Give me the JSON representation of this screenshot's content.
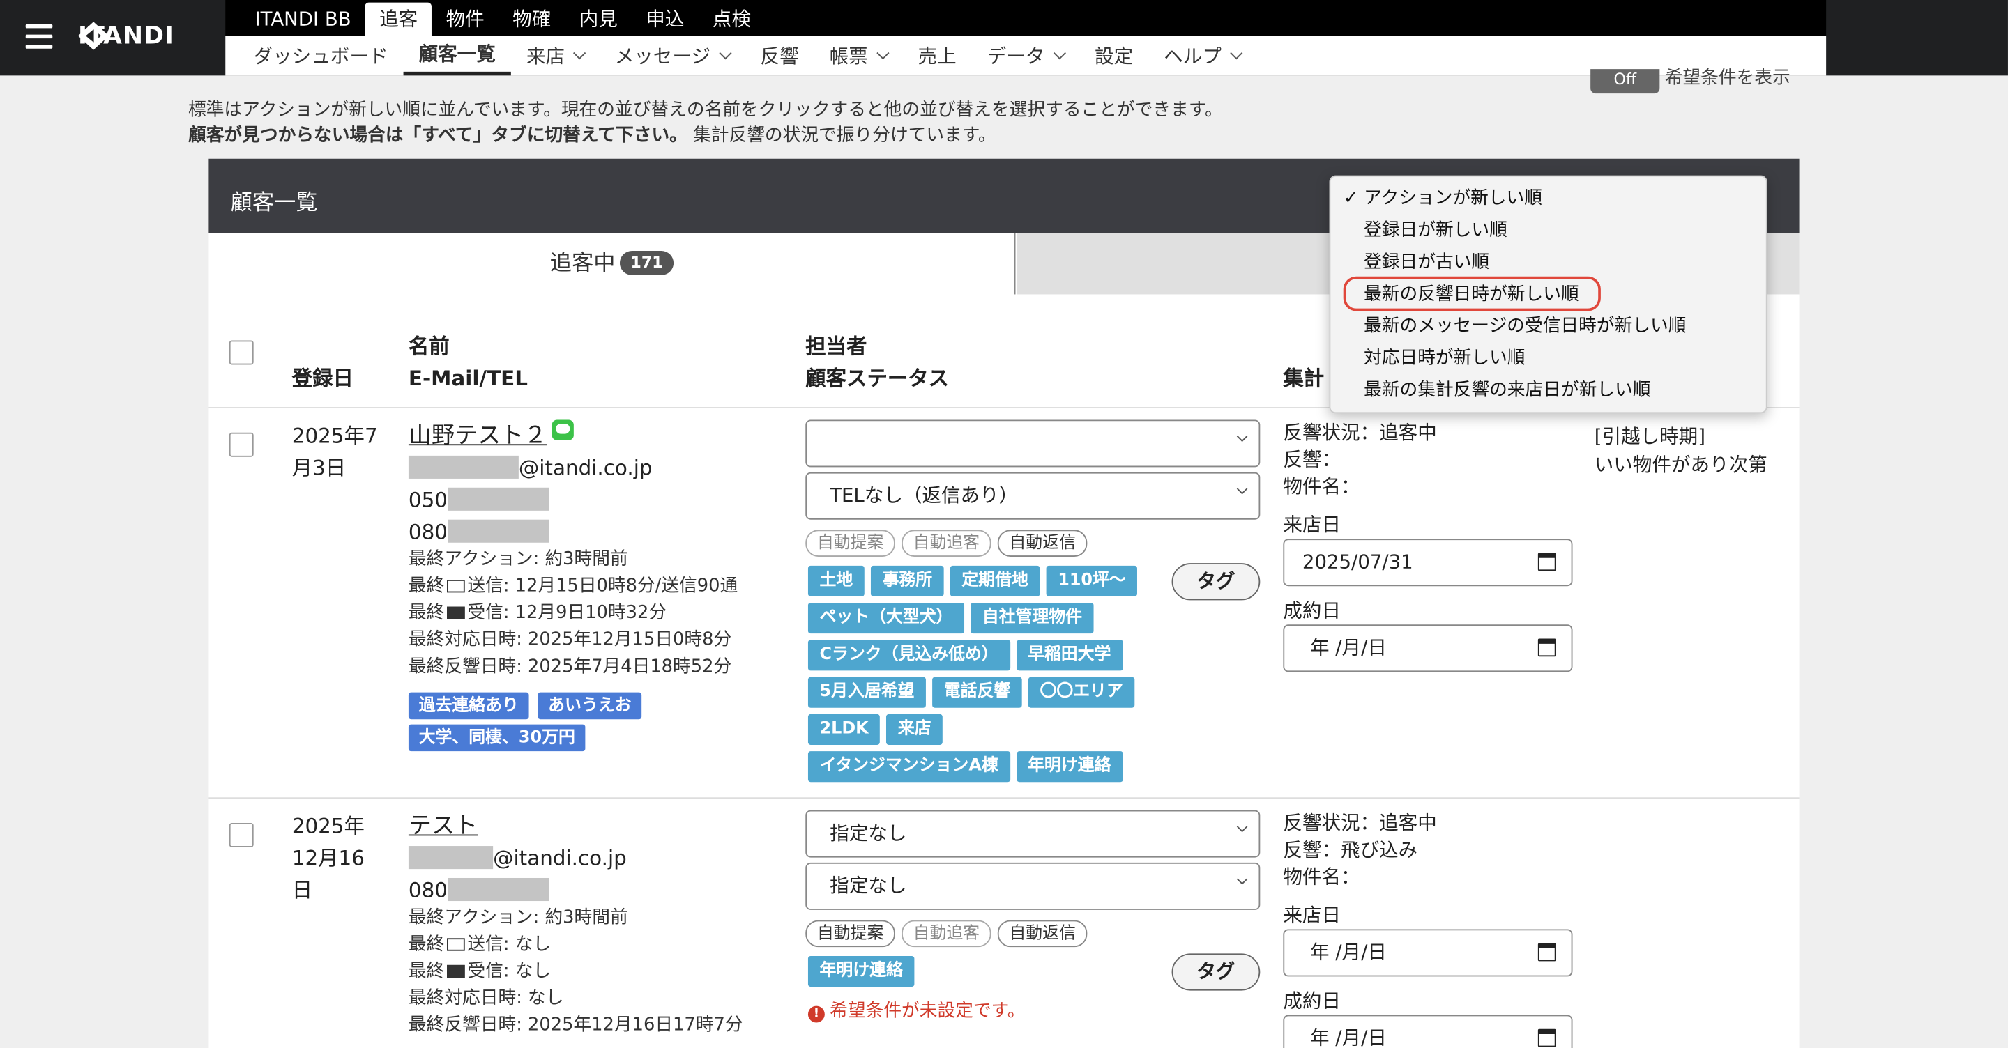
{
  "app": {
    "logo": "ITANDI"
  },
  "nav_top": [
    "ITANDI BB",
    "追客",
    "物件",
    "物確",
    "内見",
    "申込",
    "点検"
  ],
  "nav_sub": [
    {
      "label": "ダッシュボード",
      "dropdown": false
    },
    {
      "label": "顧客一覧",
      "dropdown": false
    },
    {
      "label": "来店",
      "dropdown": true
    },
    {
      "label": "メッセージ",
      "dropdown": true
    },
    {
      "label": "反響",
      "dropdown": false
    },
    {
      "label": "帳票",
      "dropdown": true
    },
    {
      "label": "売上",
      "dropdown": false
    },
    {
      "label": "データ",
      "dropdown": true
    },
    {
      "label": "設定",
      "dropdown": false
    },
    {
      "label": "ヘルプ",
      "dropdown": true
    }
  ],
  "toggle": {
    "state": "Off",
    "label": "希望条件を表示"
  },
  "info": {
    "line1": "標準はアクションが新しい順に並んでいます。現在の並び替えの名前をクリックすると他の並び替えを選択することができます。",
    "line2_bold": "顧客が見つからない場合は「すべて」タブに切替えて下さい。",
    "line2_rest": "集計反響の状況で振り分けています。"
  },
  "panel": {
    "title": "顧客一覧",
    "tab_label": "追客中",
    "tab_count": "171"
  },
  "columns": {
    "date": "登録日",
    "name1": "名前",
    "name2": "E-Mail/TEL",
    "staff1": "担当者",
    "staff2": "顧客ステータス",
    "agg": "集計"
  },
  "sort_menu": {
    "check": "✓",
    "items": [
      "アクションが新しい順",
      "登録日が新しい順",
      "登録日が古い順",
      "最新の反響日時が新しい順",
      "最新のメッセージの受信日時が新しい順",
      "対応日時が新しい順",
      "最新の集計反響の来店日が新しい順"
    ],
    "selected": "アクションが新しい順",
    "highlighted": "最新の反響日時が新しい順"
  },
  "rows": [
    {
      "date1": "2025年7",
      "date2": "月3日",
      "name": "山野テスト２",
      "email_domain": "@itandi.co.jp",
      "tel1": "050",
      "tel2": "080",
      "last_action": "最終アクション: 約3時間前",
      "sent_prefix": "最終",
      "sent": "送信: 12月15日0時8分/送信90通",
      "recv_prefix": "最終",
      "recv": "受信: 12月9日10時32分",
      "last_contact": "最終対応日時: 2025年12月15日0時8分",
      "last_response": "最終反響日時: 2025年7月4日18時52分",
      "badges": [
        "過去連絡あり",
        "あいうえお",
        "大学、同棲、30万円"
      ],
      "staff_select": "",
      "status_select": "TELなし（返信あり）",
      "pills": [
        "自動提案",
        "自動追客",
        "自動返信"
      ],
      "tags": [
        "土地",
        "事務所",
        "定期借地",
        "110坪〜",
        "ペット（大型犬）",
        "自社管理物件",
        "Cランク（見込み低め）",
        "早稲田大学",
        "5月入居希望",
        "電話反響",
        "〇〇エリア",
        "2LDK",
        "来店",
        "イタンジマンションA棟",
        "年明け連絡"
      ],
      "tag_button": "タグ",
      "response_status": "反響状況：追客中",
      "response": "反響：",
      "property": "物件名：",
      "visit_label": "来店日",
      "visit_date": "2025/07/31",
      "contract_label": "成約日",
      "contract_date": "年 /月/日",
      "move_label": "[引越し時期]",
      "move_value": "いい物件があり次第"
    },
    {
      "date1": "2025年",
      "date2": "12月16",
      "date3": "日",
      "name": "テスト",
      "email_domain": "@itandi.co.jp",
      "tel1": "080",
      "last_action": "最終アクション: 約3時間前",
      "sent_prefix": "最終",
      "sent": "送信: なし",
      "recv_prefix": "最終",
      "recv": "受信: なし",
      "last_contact": "最終対応日時: なし",
      "last_response": "最終反響日時: 2025年12月16日17時7分",
      "staff_select": "指定なし",
      "status_select": "指定なし",
      "pills": [
        "自動提案",
        "自動追客",
        "自動返信"
      ],
      "tags": [
        "年明け連絡"
      ],
      "tag_button": "タグ",
      "warning": "希望条件が未設定です。",
      "response_status": "反響状況：追客中",
      "response": "反響：飛び込み",
      "property": "物件名：",
      "visit_label": "来店日",
      "visit_date": "年 /月/日",
      "contract_label": "成約日",
      "contract_date": "年 /月/日"
    }
  ]
}
